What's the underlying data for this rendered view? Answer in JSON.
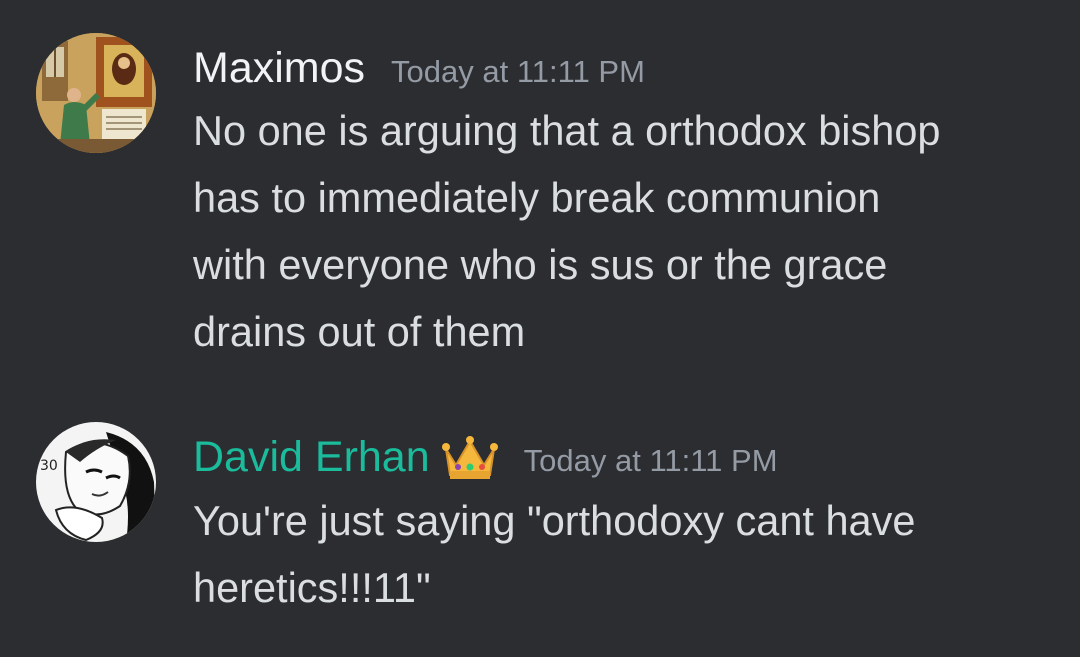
{
  "messages": [
    {
      "username": "Maximos",
      "timestamp": "Today at 11:11 PM",
      "lines": [
        "No one is arguing that a orthodox bishop",
        "has to immediately break communion",
        "with everyone who is sus or the grace",
        "drains out of them"
      ],
      "name_color": "#f2f3f5",
      "avatar": "icon-avatar"
    },
    {
      "username": "David Erhan",
      "timestamp": "Today at 11:11 PM",
      "badge_icon": "crown-icon",
      "lines": [
        "You're just saying \"orthodoxy cant have",
        "heretics!!!11\""
      ],
      "name_color": "#1abc9c",
      "avatar": "manga-avatar"
    }
  ],
  "colors": {
    "background": "#2b2d31",
    "text": "#dbdee1",
    "timestamp": "#949ba4"
  }
}
